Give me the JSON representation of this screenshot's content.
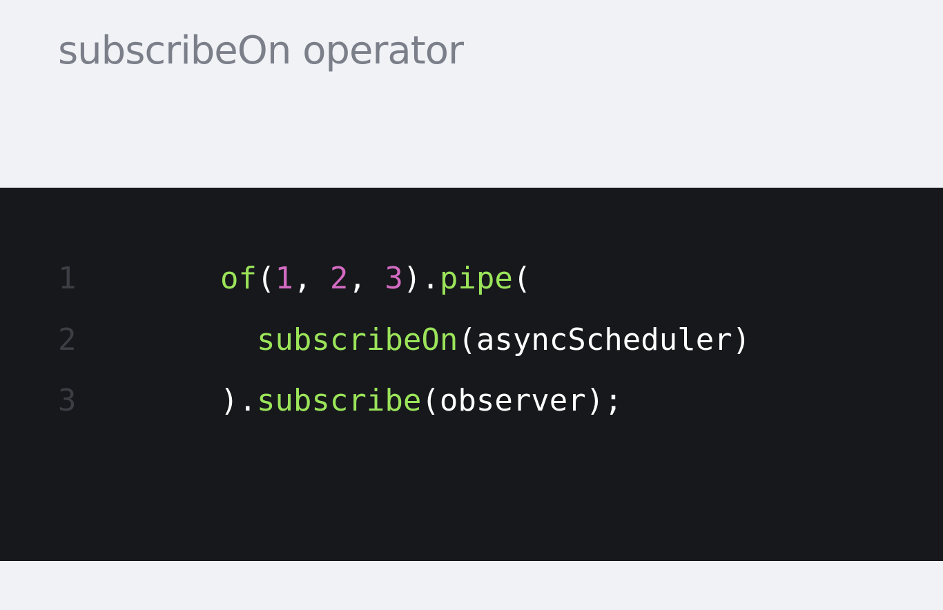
{
  "slide": {
    "title": "subscribeOn operator"
  },
  "code": {
    "lines": [
      {
        "number": "1",
        "tokens": [
          {
            "text": "of",
            "kind": "fn"
          },
          {
            "text": "(",
            "kind": "pun"
          },
          {
            "text": "1",
            "kind": "num"
          },
          {
            "text": ", ",
            "kind": "pun"
          },
          {
            "text": "2",
            "kind": "num"
          },
          {
            "text": ", ",
            "kind": "pun"
          },
          {
            "text": "3",
            "kind": "num"
          },
          {
            "text": ").",
            "kind": "pun"
          },
          {
            "text": "pipe",
            "kind": "fn"
          },
          {
            "text": "(",
            "kind": "pun"
          }
        ]
      },
      {
        "number": "2",
        "tokens": [
          {
            "text": "  ",
            "kind": "pun"
          },
          {
            "text": "subscribeOn",
            "kind": "fn"
          },
          {
            "text": "(",
            "kind": "pun"
          },
          {
            "text": "asyncScheduler",
            "kind": "id"
          },
          {
            "text": ")",
            "kind": "pun"
          }
        ]
      },
      {
        "number": "3",
        "tokens": [
          {
            "text": ").",
            "kind": "pun"
          },
          {
            "text": "subscribe",
            "kind": "fn"
          },
          {
            "text": "(",
            "kind": "pun"
          },
          {
            "text": "observer",
            "kind": "id"
          },
          {
            "text": ");",
            "kind": "pun"
          }
        ]
      }
    ]
  },
  "colors": {
    "background": "#f1f2f6",
    "title": "#7b7f89",
    "code_background": "#17181c",
    "function": "#9be45a",
    "number": "#d36bc3",
    "plain": "#ffffff",
    "line_number": "#3c3e44"
  }
}
